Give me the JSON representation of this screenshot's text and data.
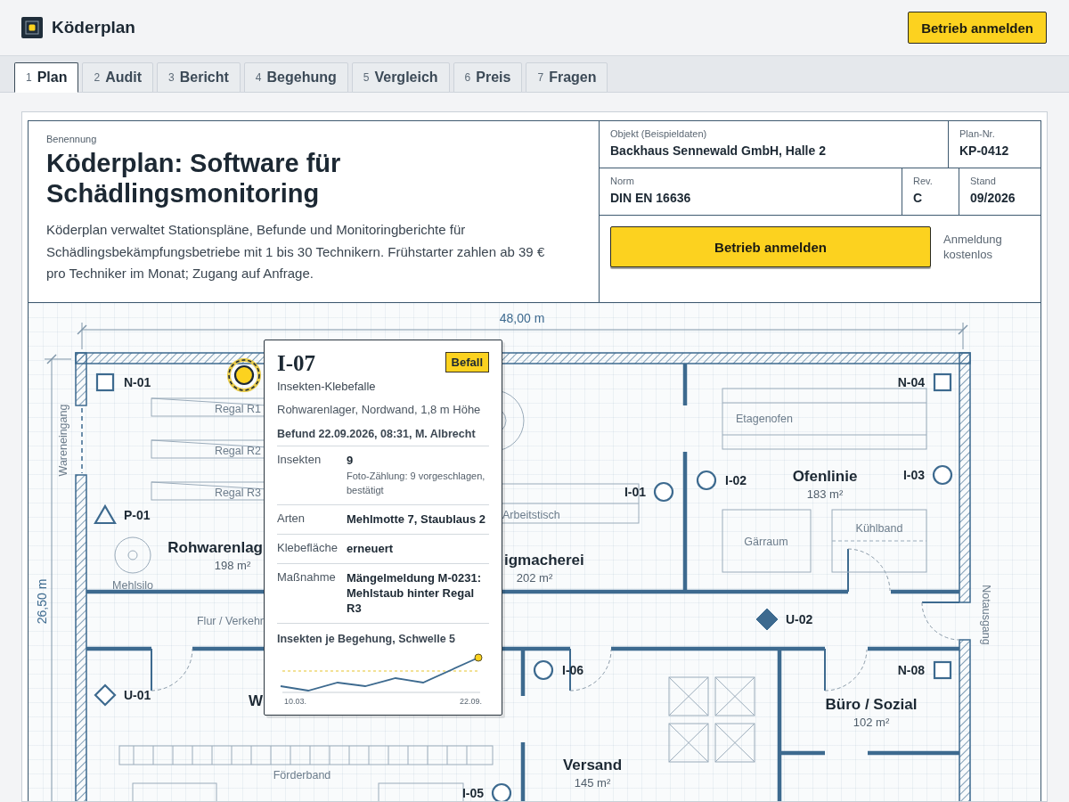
{
  "app": {
    "name": "Köderplan",
    "cta": "Betrieb anmelden"
  },
  "tabs": [
    {
      "number": "1",
      "label": "Plan",
      "selected": true
    },
    {
      "number": "2",
      "label": "Audit",
      "selected": false
    },
    {
      "number": "3",
      "label": "Bericht",
      "selected": false
    },
    {
      "number": "4",
      "label": "Begehung",
      "selected": false
    },
    {
      "number": "5",
      "label": "Vergleich",
      "selected": false
    },
    {
      "number": "6",
      "label": "Preis",
      "selected": false
    },
    {
      "number": "7",
      "label": "Fragen",
      "selected": false
    }
  ],
  "title_block": {
    "caption": "Benennung",
    "heading": "Köderplan: Software für Schädlingsmonitoring",
    "description": "Köderplan verwaltet Stationspläne, Befunde und Monitoringberichte für Schädlingsbekämpfungsbetriebe mit 1 bis 30 Technikern. Frühstarter zahlen ab 39 € pro Techniker im Monat; Zugang auf Anfrage.",
    "rows": [
      {
        "fields": [
          {
            "label": "Objekt (Beispieldaten)",
            "value": "Backhaus Sennewald GmbH, Halle 2"
          },
          {
            "label": "Plan-Nr.",
            "value": "KP-0412"
          }
        ]
      },
      {
        "fields": [
          {
            "label": "Norm",
            "value": "DIN EN 16636"
          },
          {
            "label": "Rev.",
            "value": "C"
          },
          {
            "label": "Stand",
            "value": "09/2026"
          }
        ]
      }
    ],
    "cta": "Betrieb anmelden",
    "cta_note": "Anmeldung kostenlos"
  },
  "plan": {
    "width_dimension": "48,00 m",
    "height_dimension": "26,50 m",
    "rooms": [
      {
        "name": "Rohwarenlag",
        "area": "198 m²"
      },
      {
        "name": "igmacherei",
        "area": "202 m²"
      },
      {
        "name": "Ofenlinie",
        "area": "183 m²"
      },
      {
        "name": "W"
      },
      {
        "name": "Büro / Sozial",
        "area": "102 m²"
      },
      {
        "name": "Versand",
        "area": "145 m²"
      }
    ],
    "fixtures": [
      {
        "label": "Regal R1"
      },
      {
        "label": "Regal R2"
      },
      {
        "label": "Regal R3"
      },
      {
        "label": "Mehlsilo"
      },
      {
        "label": "Arbeitstisch"
      },
      {
        "label": "Etagenofen"
      },
      {
        "label": "Gärraum"
      },
      {
        "label": "Kühlband"
      },
      {
        "label": "Förderband"
      }
    ],
    "zones": [
      {
        "label": "Wareneingang"
      },
      {
        "label": "Flur / Verkehr"
      },
      {
        "label": "Notausgang"
      }
    ],
    "stations": [
      {
        "kind": "circle",
        "selected": true
      },
      {
        "label": "N-01",
        "kind": "square",
        "selected": false
      },
      {
        "label": "N-04",
        "kind": "square",
        "selected": false
      },
      {
        "label": "I-03",
        "kind": "circle",
        "selected": false
      },
      {
        "label": "I-02",
        "kind": "circle",
        "selected": false
      },
      {
        "label": "I-01",
        "kind": "circle",
        "selected": false
      },
      {
        "label": "P-01",
        "kind": "triangle",
        "selected": false
      },
      {
        "label": "U-02",
        "kind": "diamond-filled",
        "selected": false
      },
      {
        "label": "I-06",
        "kind": "circle",
        "selected": false
      },
      {
        "label": "N-08",
        "kind": "square",
        "selected": false
      },
      {
        "label": "U-01",
        "kind": "diamond",
        "selected": false
      },
      {
        "label": "I-05",
        "kind": "circle",
        "selected": false
      }
    ],
    "popup": {
      "id": "I-07",
      "badge": "Befall",
      "type": "Insekten-Klebefalle",
      "location": "Rohwarenlager, Nordwand, 1,8 m Höhe",
      "finding": "Befund 22.09.2026, 08:31, M. Albrecht",
      "rows": [
        {
          "label": "Insekten",
          "value": "9",
          "note": "Foto-Zählung: 9 vorgeschlagen, bestätigt"
        },
        {
          "label": "Arten",
          "value": "Mehlmotte 7, Staublaus 2"
        },
        {
          "label": "Klebefläche",
          "value": "erneuert"
        },
        {
          "label": "Maßnahme",
          "value": "Mängelmeldung M-0231: Mehlstaub hinter Regal R3"
        }
      ],
      "chart_title": "Insekten je Begehung, Schwelle 5",
      "x_start": "10.03.",
      "x_end": "22.09."
    }
  }
}
